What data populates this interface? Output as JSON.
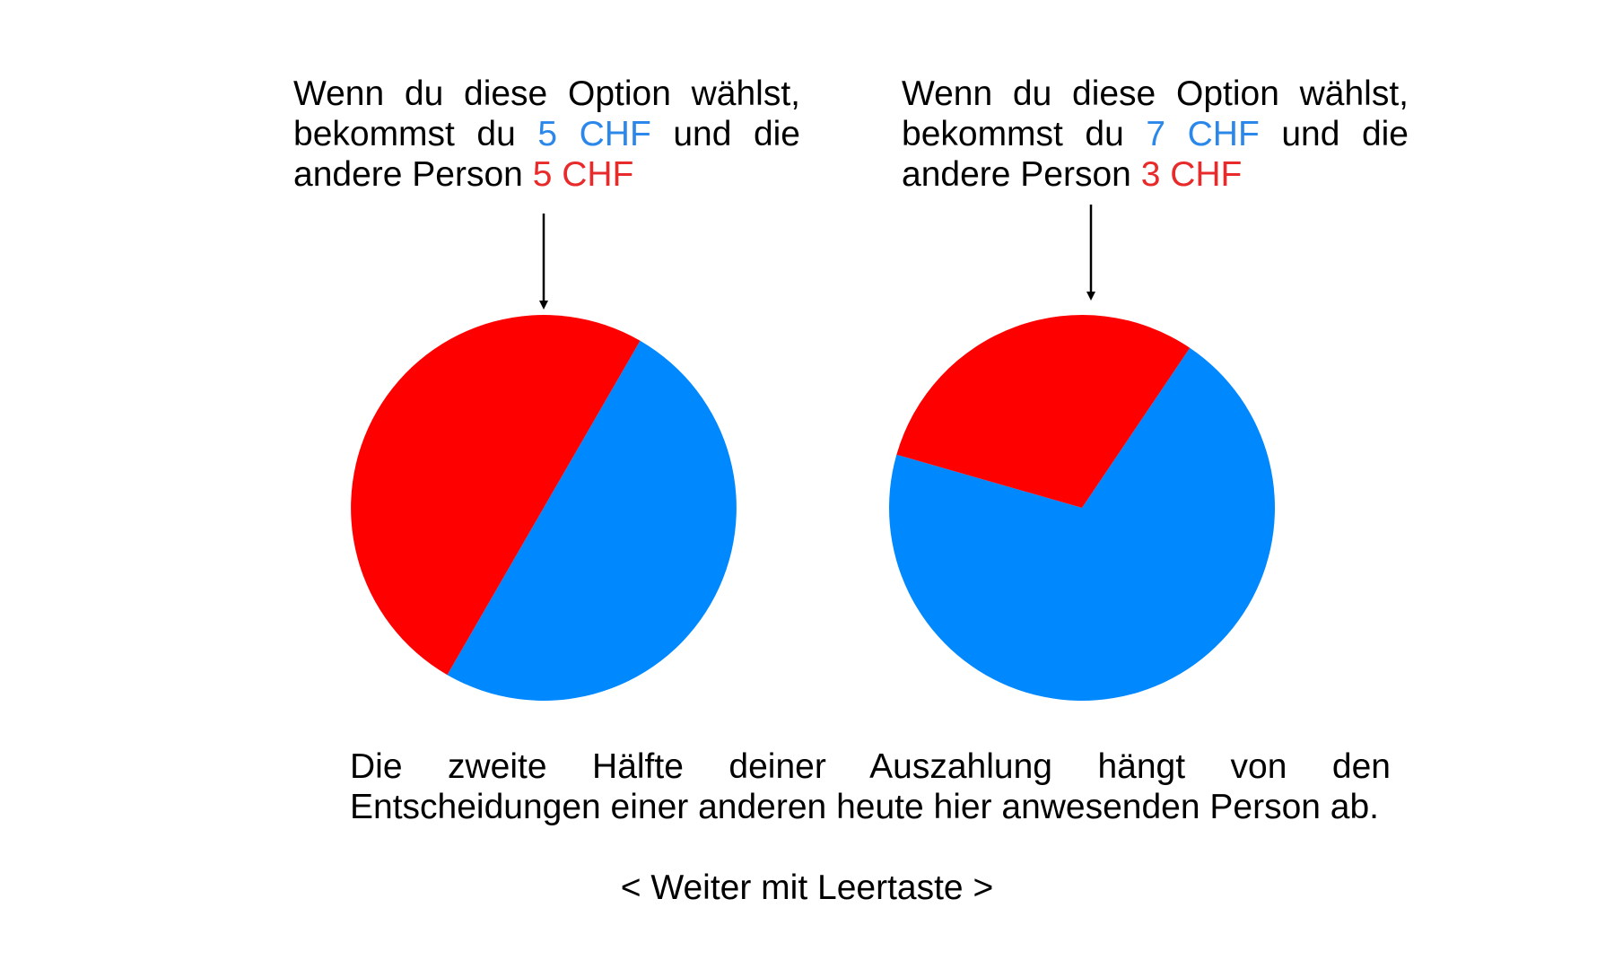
{
  "colors": {
    "self": "#0088ff",
    "other": "#ff0000",
    "self_text": "#2b87ea",
    "other_text": "#e82a2a"
  },
  "options": [
    {
      "line_prefix": "Wenn du diese Option wählst, bekommst du",
      "self_amount": "5 CHF",
      "line_middle": "und die andere Person",
      "other_amount": "5 CHF"
    },
    {
      "line_prefix": "Wenn du diese Option wählst, bekommst du",
      "self_amount": "7 CHF",
      "line_middle": "und die andere Person",
      "other_amount": "3 CHF"
    }
  ],
  "chart_data": [
    {
      "type": "pie",
      "slices": [
        {
          "label": "du",
          "value": 5,
          "color": "#0088ff"
        },
        {
          "label": "andere Person",
          "value": 5,
          "color": "#ff0000"
        }
      ]
    },
    {
      "type": "pie",
      "slices": [
        {
          "label": "du",
          "value": 7,
          "color": "#0088ff"
        },
        {
          "label": "andere Person",
          "value": 3,
          "color": "#ff0000"
        }
      ]
    }
  ],
  "footer": {
    "text": "Die zweite Hälfte deiner Auszahlung hängt von den Entscheidungen einer anderen heute hier anwesenden Person ab.",
    "continue_hint": "< Weiter mit Leertaste >"
  }
}
